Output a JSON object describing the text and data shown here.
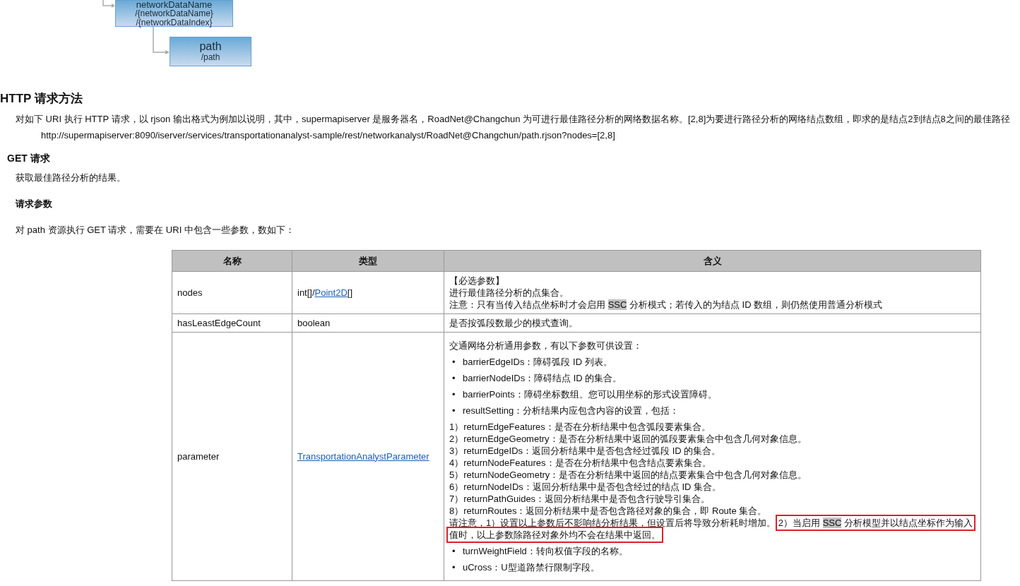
{
  "diagram": {
    "nodes": [
      {
        "title": "networkDataName",
        "subtitles": [
          "/{networkDataName}",
          "/{networkDataIndex}"
        ]
      },
      {
        "title": "path",
        "subtitles": [
          "/path"
        ]
      }
    ]
  },
  "section": {
    "title": "HTTP 请求方法",
    "intro": "对如下 URI 执行 HTTP 请求，以 rjson 输出格式为例加以说明，其中，supermapiserver 是服务器名，RoadNet@Changchun 为可进行最佳路径分析的网络数据名称。[2,8]为要进行路径分析的网络结点数组，即求的是结点2到结点8之间的最佳路径",
    "url": "http://supermapiserver:8090/iserver/services/transportationanalyst-sample/rest/networkanalyst/RoadNet@Changchun/path.rjson?nodes=[2,8]"
  },
  "get": {
    "title": "GET 请求",
    "description": "获取最佳路径分析的结果。",
    "params_title": "请求参数",
    "params_intro": "对 path 资源执行 GET 请求，需要在 URI 中包含一些参数，数如下："
  },
  "table": {
    "columns": [
      "名称",
      "类型",
      "含义"
    ],
    "rows": [
      {
        "name": "nodes",
        "type": [
          {
            "text": "int[]/",
            "link": false
          },
          {
            "text": "Point2D",
            "link": true
          },
          {
            "text": "[]",
            "link": false
          }
        ],
        "meaning": [
          {
            "kind": "line",
            "segments": [
              {
                "text": "【必选参数】",
                "highlight": false,
                "boxed": false
              }
            ]
          },
          {
            "kind": "line",
            "segments": [
              {
                "text": "进行最佳路径分析的点集合。",
                "highlight": false,
                "boxed": false
              }
            ]
          },
          {
            "kind": "line",
            "segments": [
              {
                "text": "注意：只有当传入结点坐标时才会启用 ",
                "highlight": false,
                "boxed": false
              },
              {
                "text": "SSC",
                "highlight": true,
                "boxed": false
              },
              {
                "text": " 分析模式；若传入的为结点 ID 数组，则仍然使用普通分析模式",
                "highlight": false,
                "boxed": false
              }
            ]
          }
        ]
      },
      {
        "name": "hasLeastEdgeCount",
        "type": [
          {
            "text": "boolean",
            "link": false
          }
        ],
        "meaning": [
          {
            "kind": "line",
            "segments": [
              {
                "text": "是否按弧段数最少的模式查询。",
                "highlight": false,
                "boxed": false
              }
            ]
          }
        ]
      },
      {
        "name": "parameter",
        "type": [
          {
            "text": "TransportationAnalystParameter",
            "link": true
          }
        ],
        "meaning": [
          {
            "kind": "para",
            "segments": [
              {
                "text": "交通网络分析通用参数，有以下参数可供设置：",
                "highlight": false,
                "boxed": false
              }
            ]
          },
          {
            "kind": "bullet",
            "marker": "•",
            "segments": [
              {
                "text": "barrierEdgeIDs：障碍弧段 ID 列表。",
                "highlight": false,
                "boxed": false
              }
            ]
          },
          {
            "kind": "bullet",
            "marker": "•",
            "segments": [
              {
                "text": "barrierNodeIDs：障碍结点 ID 的集合。",
                "highlight": false,
                "boxed": false
              }
            ]
          },
          {
            "kind": "bullet",
            "marker": "•",
            "segments": [
              {
                "text": "barrierPoints：障碍坐标数组。您可以用坐标的形式设置障碍。",
                "highlight": false,
                "boxed": false
              }
            ]
          },
          {
            "kind": "bullet",
            "marker": "•",
            "segments": [
              {
                "text": "resultSetting：分析结果内应包含内容的设置，包括：",
                "highlight": false,
                "boxed": false
              }
            ]
          },
          {
            "kind": "para",
            "segments": [
              {
                "text": "1）returnEdgeFeatures：是否在分析结果中包含弧段要素集合。",
                "highlight": false,
                "boxed": false
              }
            ]
          },
          {
            "kind": "line",
            "segments": [
              {
                "text": "2）returnEdgeGeometry：是否在分析结果中返回的弧段要素集合中包含几何对象信息。",
                "highlight": false,
                "boxed": false
              }
            ]
          },
          {
            "kind": "line",
            "segments": [
              {
                "text": "3）returnEdgeIDs：返回分析结果中是否包含经过弧段 ID 的集合。",
                "highlight": false,
                "boxed": false
              }
            ]
          },
          {
            "kind": "line",
            "segments": [
              {
                "text": "4）returnNodeFeatures：是否在分析结果中包含结点要素集合。",
                "highlight": false,
                "boxed": false
              }
            ]
          },
          {
            "kind": "line",
            "segments": [
              {
                "text": "5）returnNodeGeometry：是否在分析结果中返回的结点要素集合中包含几何对象信息。",
                "highlight": false,
                "boxed": false
              }
            ]
          },
          {
            "kind": "line",
            "segments": [
              {
                "text": "6）returnNodeIDs：返回分析结果中是否包含经过的结点 ID 集合。",
                "highlight": false,
                "boxed": false
              }
            ]
          },
          {
            "kind": "line",
            "segments": [
              {
                "text": "7）returnPathGuides：返回分析结果中是否包含行驶导引集合。",
                "highlight": false,
                "boxed": false
              }
            ]
          },
          {
            "kind": "line",
            "segments": [
              {
                "text": "8）returnRoutes：返回分析结果中是否包含路径对象的集合，即 Route 集合。",
                "highlight": false,
                "boxed": false
              }
            ]
          },
          {
            "kind": "line",
            "segments": [
              {
                "text": "请注意，1）设置以上参数后不影响结分析结果，但设置后将导致分析耗时增加。 ",
                "highlight": false,
                "boxed": false
              },
              {
                "text": "2）当启用 ",
                "highlight": false,
                "boxed": true
              },
              {
                "text": "SSC",
                "highlight": true,
                "boxed": true
              },
              {
                "text": " 分析模型并以结点坐标作为输入",
                "highlight": false,
                "boxed": true
              }
            ]
          },
          {
            "kind": "line",
            "segments": [
              {
                "text": "值时，以上参数除路径对象外均不会在结果中返回。",
                "highlight": false,
                "boxed": true
              }
            ]
          },
          {
            "kind": "bullet",
            "marker": "•",
            "segments": [
              {
                "text": "turnWeightField：转向权值字段的名称。",
                "highlight": false,
                "boxed": false
              }
            ]
          },
          {
            "kind": "bullet",
            "marker": "•",
            "segments": [
              {
                "text": "uCross：U型道路禁行限制字段。",
                "highlight": false,
                "boxed": false
              }
            ]
          }
        ]
      }
    ]
  }
}
